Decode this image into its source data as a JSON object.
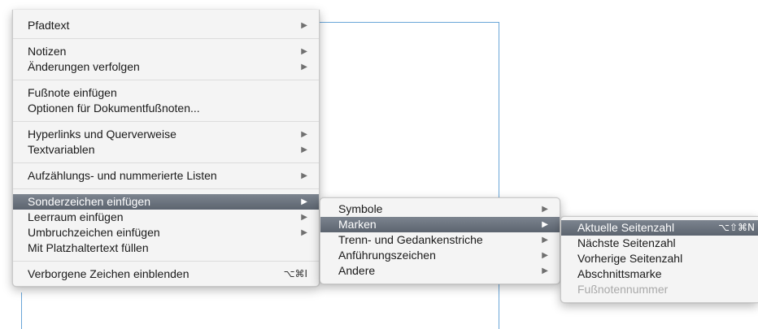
{
  "main_menu": {
    "items": [
      {
        "label": "Pfadtext",
        "submenu": true
      },
      {
        "label": "Notizen",
        "submenu": true
      },
      {
        "label": "Änderungen verfolgen",
        "submenu": true
      },
      {
        "label": "Fußnote einfügen"
      },
      {
        "label": "Optionen für Dokumentfußnoten..."
      },
      {
        "label": "Hyperlinks und Querverweise",
        "submenu": true
      },
      {
        "label": "Textvariablen",
        "submenu": true
      },
      {
        "label": "Aufzählungs- und nummerierte Listen",
        "submenu": true
      },
      {
        "label": "Sonderzeichen einfügen",
        "submenu": true,
        "highlighted": true
      },
      {
        "label": "Leerraum einfügen",
        "submenu": true
      },
      {
        "label": "Umbruchzeichen einfügen",
        "submenu": true
      },
      {
        "label": "Mit Platzhaltertext füllen"
      },
      {
        "label": "Verborgene Zeichen einblenden",
        "shortcut": "⌥⌘I"
      }
    ]
  },
  "sub_menu": {
    "items": [
      {
        "label": "Symbole",
        "submenu": true
      },
      {
        "label": "Marken",
        "submenu": true,
        "highlighted": true
      },
      {
        "label": "Trenn- und Gedankenstriche",
        "submenu": true
      },
      {
        "label": "Anführungszeichen",
        "submenu": true
      },
      {
        "label": "Andere",
        "submenu": true
      }
    ]
  },
  "marken_menu": {
    "items": [
      {
        "label": "Aktuelle Seitenzahl",
        "shortcut": "⌥⇧⌘N",
        "highlighted": true
      },
      {
        "label": "Nächste Seitenzahl"
      },
      {
        "label": "Vorherige Seitenzahl"
      },
      {
        "label": "Abschnittsmarke"
      },
      {
        "label": "Fußnotennummer",
        "disabled": true
      }
    ]
  },
  "glyphs": {
    "submenu_arrow": "▶"
  },
  "colors": {
    "highlight": "#6a727d",
    "guide": "#6aa6d8"
  }
}
